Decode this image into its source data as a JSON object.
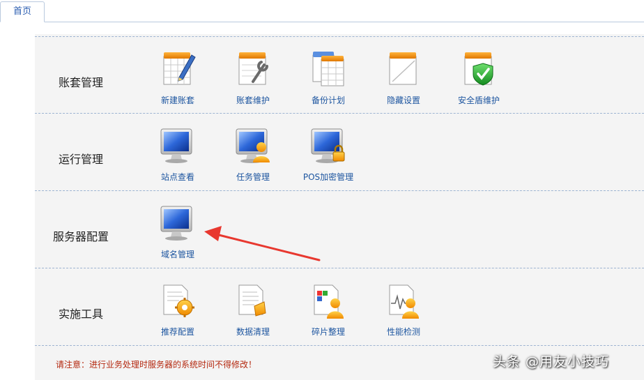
{
  "tab": {
    "label": "首页"
  },
  "sections": [
    {
      "title": "账套管理",
      "items": [
        {
          "label": "新建账套",
          "icon": "new-account-icon"
        },
        {
          "label": "账套维护",
          "icon": "account-maintenance-icon"
        },
        {
          "label": "备份计划",
          "icon": "backup-plan-icon"
        },
        {
          "label": "隐藏设置",
          "icon": "hidden-settings-icon"
        },
        {
          "label": "安全盾维护",
          "icon": "security-shield-icon"
        }
      ]
    },
    {
      "title": "运行管理",
      "items": [
        {
          "label": "站点查看",
          "icon": "monitor-icon"
        },
        {
          "label": "任务管理",
          "icon": "task-management-icon"
        },
        {
          "label": "POS加密管理",
          "icon": "pos-encryption-icon"
        }
      ]
    },
    {
      "title": "服务器配置",
      "items": [
        {
          "label": "域名管理",
          "icon": "monitor-icon"
        }
      ]
    },
    {
      "title": "实施工具",
      "items": [
        {
          "label": "推荐配置",
          "icon": "recommended-config-icon"
        },
        {
          "label": "数据清理",
          "icon": "data-cleanup-icon"
        },
        {
          "label": "碎片整理",
          "icon": "defragment-icon"
        },
        {
          "label": "性能检测",
          "icon": "performance-check-icon"
        }
      ]
    }
  ],
  "notice": "请注意：进行业务处理时服务器的系统时间不得修改！",
  "watermark": "头条 @用友小技巧",
  "colors": {
    "accent": "#1e56a0",
    "notice": "#b4280f",
    "arrow": "#e8382f",
    "folder": "#f39c12"
  }
}
